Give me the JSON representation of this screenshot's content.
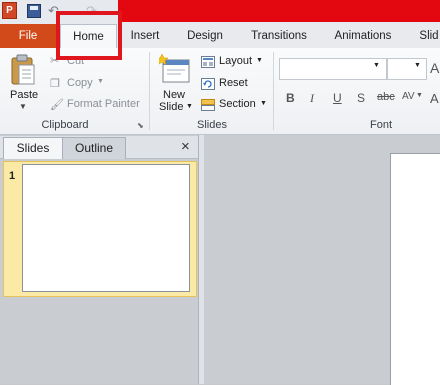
{
  "titlebar": {
    "app_icon_letter": "P"
  },
  "tabs": [
    {
      "label": "File"
    },
    {
      "label": "Home"
    },
    {
      "label": "Insert"
    },
    {
      "label": "Design"
    },
    {
      "label": "Transitions"
    },
    {
      "label": "Animations"
    },
    {
      "label": "Slid"
    }
  ],
  "clipboard": {
    "paste_label": "Paste",
    "cut_label": "Cut",
    "copy_label": "Copy",
    "format_painter_label": "Format Painter",
    "group_label": "Clipboard"
  },
  "slides_group": {
    "new_slide_label_1": "New",
    "new_slide_label_2": "Slide",
    "layout_label": "Layout",
    "reset_label": "Reset",
    "section_label": "Section",
    "group_label": "Slides"
  },
  "font_group": {
    "bold": "B",
    "italic": "I",
    "underline": "U",
    "shadow": "S",
    "strikethrough": "abc",
    "spacing": "AV",
    "group_label": "Font"
  },
  "pane": {
    "tab_slides": "Slides",
    "tab_outline": "Outline",
    "close": "×",
    "slide_number": "1"
  },
  "colors": {
    "accent_red": "#e3070f",
    "file_tab": "#d24a1a",
    "selection": "#fbe9a6"
  }
}
